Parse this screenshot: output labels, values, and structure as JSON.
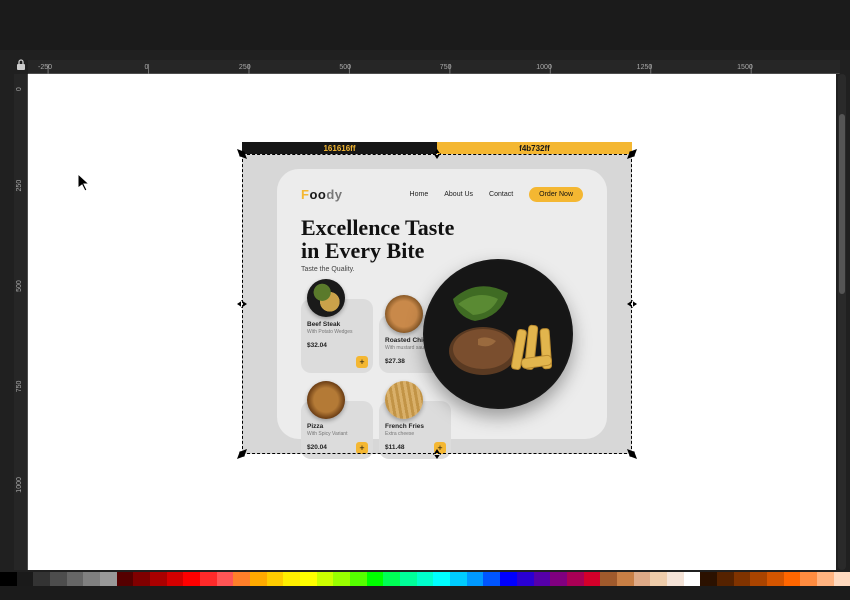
{
  "app": {
    "ruler_h_labels": [
      "-250",
      "0",
      "250",
      "500",
      "750",
      "1000",
      "1250",
      "1500"
    ],
    "ruler_v_labels": [
      "0",
      "250",
      "500",
      "750",
      "1000"
    ]
  },
  "swatches": {
    "left_label": "161616ff",
    "right_label": "f4b732ff",
    "left_color": "#161616",
    "right_color": "#f4b732"
  },
  "design": {
    "brand_a": "F",
    "brand_b": "oo",
    "brand_c": "dy",
    "nav": {
      "home": "Home",
      "about": "About Us",
      "contact": "Contact",
      "cta": "Order Now"
    },
    "headline_l1": "Excellence Taste",
    "headline_l2": "in Every Bite",
    "tagline": "Taste the Quality.",
    "cards": [
      {
        "name": "Beef Steak",
        "desc": "With Potato Wedges",
        "price": "$32.04"
      },
      {
        "name": "Roasted Chicken",
        "desc": "With mustard sauce",
        "price": "$27.38"
      },
      {
        "name": "Pizza",
        "desc": "With Spicy Variant",
        "price": "$20.04"
      },
      {
        "name": "French Fries",
        "desc": "Extra cheese",
        "price": "$11.48"
      }
    ],
    "plus": "+"
  },
  "palette": [
    "#000000",
    "#1a1a1a",
    "#333333",
    "#4d4d4d",
    "#666666",
    "#808080",
    "#999999",
    "#550000",
    "#800000",
    "#aa0000",
    "#d40000",
    "#ff0000",
    "#ff2a2a",
    "#ff5555",
    "#ff7f2a",
    "#ffaa00",
    "#ffcc00",
    "#ffee00",
    "#ffff00",
    "#ccff00",
    "#99ff00",
    "#55ff00",
    "#00ff00",
    "#00ff55",
    "#00ff99",
    "#00ffcc",
    "#00ffff",
    "#00ccff",
    "#0099ff",
    "#0055ff",
    "#0000ff",
    "#2a00d4",
    "#5500aa",
    "#800080",
    "#aa0055",
    "#d4002a",
    "#a05a2c",
    "#c87f45",
    "#deaa87",
    "#eeccaa",
    "#f4e3d7",
    "#ffffff",
    "#2b1100",
    "#552200",
    "#803300",
    "#aa4400",
    "#d45500",
    "#ff6600",
    "#ff8c40",
    "#ffb380",
    "#ffd9bf"
  ]
}
